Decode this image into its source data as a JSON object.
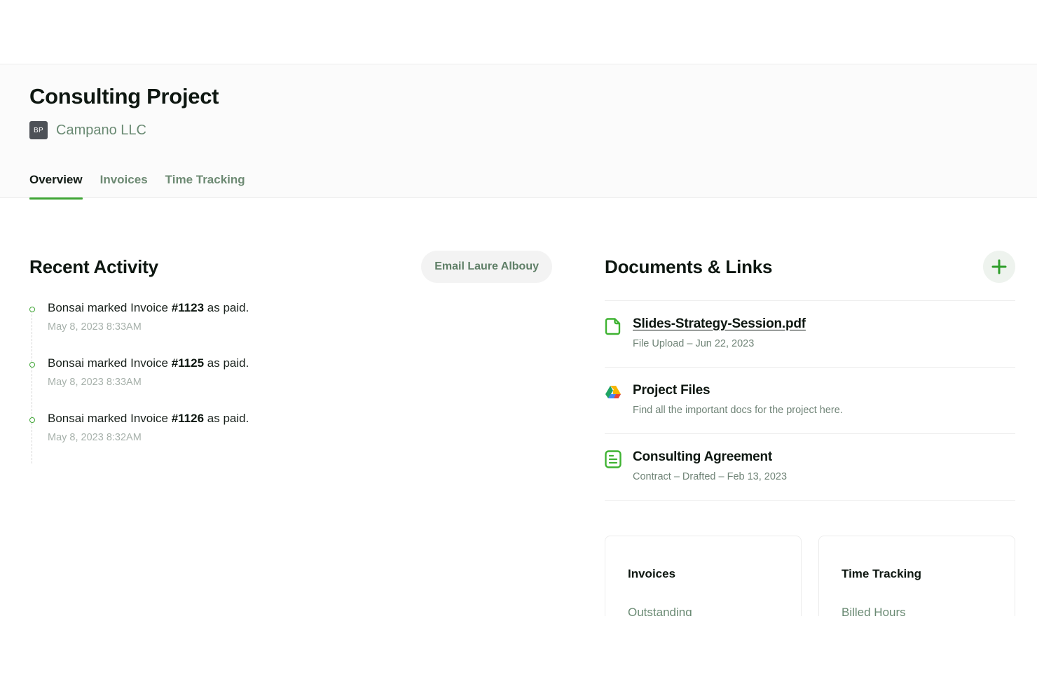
{
  "header": {
    "title": "Consulting Project",
    "client": {
      "avatar_initials": "BP",
      "name": "Campano LLC"
    },
    "tabs": [
      {
        "label": "Overview",
        "active": true
      },
      {
        "label": "Invoices",
        "active": false
      },
      {
        "label": "Time Tracking",
        "active": false
      }
    ]
  },
  "activity": {
    "title": "Recent Activity",
    "email_button": "Email Laure Albouy",
    "items": [
      {
        "prefix": "Bonsai marked Invoice ",
        "invoice": "#1123",
        "suffix": " as paid.",
        "time": "May 8, 2023 8:33AM"
      },
      {
        "prefix": "Bonsai marked Invoice ",
        "invoice": "#1125",
        "suffix": " as paid.",
        "time": "May 8, 2023 8:33AM"
      },
      {
        "prefix": "Bonsai marked Invoice ",
        "invoice": "#1126",
        "suffix": " as paid.",
        "time": "May 8, 2023 8:32AM"
      }
    ]
  },
  "documents": {
    "title": "Documents & Links",
    "add_icon": "plus-icon",
    "items": [
      {
        "icon": "file-icon",
        "title": "Slides-Strategy-Session.pdf",
        "subtitle": "File Upload – Jun 22, 2023"
      },
      {
        "icon": "google-drive-icon",
        "title": "Project Files",
        "subtitle": "Find all the important docs for the project here."
      },
      {
        "icon": "contract-icon",
        "title": "Consulting Agreement",
        "subtitle": "Contract – Drafted – Feb 13, 2023"
      }
    ]
  },
  "summary_cards": [
    {
      "title": "Invoices",
      "label": "Outstanding"
    },
    {
      "title": "Time Tracking",
      "label": "Billed Hours"
    }
  ],
  "colors": {
    "accent_green": "#3fa535",
    "muted_green_text": "#6a8a73",
    "heading": "#0e1711"
  }
}
